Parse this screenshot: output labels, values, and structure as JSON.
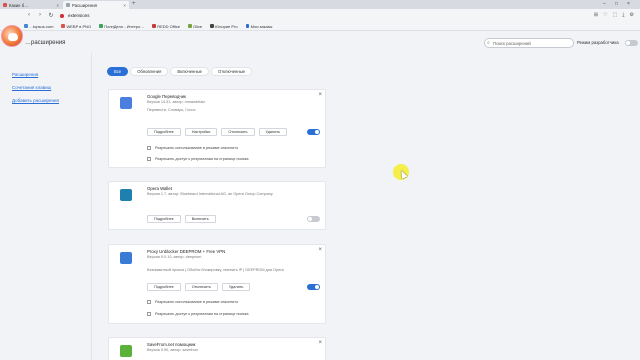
{
  "tabs": [
    {
      "title": "Какие б…",
      "active": false
    },
    {
      "title": "Расширения",
      "active": true
    }
  ],
  "address": {
    "url": "extensions"
  },
  "bookmarks": [
    {
      "label": "…topsus.com",
      "color": "#4a86d8"
    },
    {
      "label": "WEBP в PNG",
      "color": "#d9534f"
    },
    {
      "label": "ПолпДело - Интеро…",
      "color": "#3ca35c"
    },
    {
      "label": "REDD Office",
      "color": "#c73b3b"
    },
    {
      "label": "Olive",
      "color": "#7ba23f"
    },
    {
      "label": "Юпорие Pro",
      "color": "#444"
    },
    {
      "label": "Мои заказы",
      "color": "#2a6fd6"
    }
  ],
  "header": {
    "title": "…расширения",
    "search_placeholder": "Поиск расширений",
    "dev_mode_label": "Режим разработчика"
  },
  "sidebar": {
    "items": [
      {
        "label": "Расширения"
      },
      {
        "label": "Сочетания клавиш"
      },
      {
        "label": "Добавить расширения"
      }
    ]
  },
  "filters": [
    {
      "label": "Все",
      "active": true
    },
    {
      "label": "Обновления",
      "active": false
    },
    {
      "label": "Включенные",
      "active": false
    },
    {
      "label": "Отключенные",
      "active": false
    }
  ],
  "extensions": [
    {
      "name": "Google Переводчик",
      "version": "Версия 14.31, автор: mmandelaiz",
      "description": "Перевести, Словарь, Голос",
      "buttons": [
        "Подробнее",
        "Настройки",
        "Отключить",
        "Удалить"
      ],
      "enabled": true,
      "icon_color": "#4a7fe0",
      "checkboxes": [
        "Разрешить использование в режиме инкогнито",
        "Разрешить доступ к результатам на странице поиска"
      ]
    },
    {
      "name": "Opera Wallet",
      "version": "Версия 1.7, автор: Bluebeard International AG, an Opera Group Company",
      "description": "",
      "buttons": [
        "Подробнее",
        "Включить"
      ],
      "enabled": false,
      "icon_color": "#1f7fae",
      "checkboxes": []
    },
    {
      "name": "Proxy Unblocker DEEPROM + Free VPN",
      "version": "Версия 9.0.10, автор: deepnom",
      "description": "Безлимитный прокси | Обойти блокировку, сменить IP | DEEPROM для Opera",
      "buttons": [
        "Подробнее",
        "Отключить",
        "Удалить"
      ],
      "enabled": true,
      "icon_color": "#3a7bd5",
      "checkboxes": [
        "Разрешить использование в режиме инкогнито",
        "Разрешить доступ к результатам на странице поиска"
      ]
    },
    {
      "name": "SaveFrom.net помощник",
      "version": "Версия 9.90, автор: savefrom",
      "description": "",
      "buttons": [],
      "enabled": true,
      "icon_color": "#5bb23a",
      "checkboxes": []
    }
  ]
}
